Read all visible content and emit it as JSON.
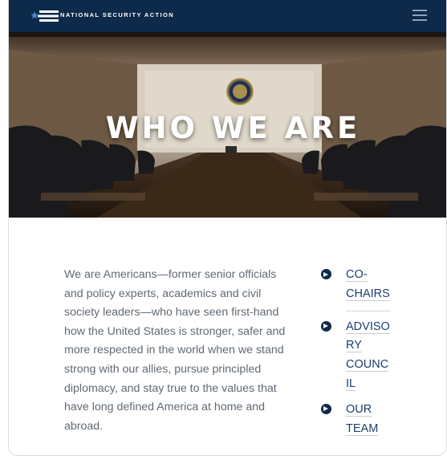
{
  "header": {
    "brand": "NATIONAL SECURITY ACTION",
    "logo_icon": "flag-stars-icon",
    "menu_icon": "hamburger-menu-icon"
  },
  "hero": {
    "title": "WHO WE ARE",
    "image": "situation-room-conference-table"
  },
  "intro": {
    "text": "We are Americans—former senior officials and policy experts, academics and civil society leaders—who have seen first-hand how the United States is stronger, safer and more respected in the world when we stand strong with our allies, pursue principled diplomacy, and stay true to the values that have long defined America at home and abroad."
  },
  "links": [
    {
      "label": "CO-CHAIRS",
      "icon": "arrow-circle-right-icon"
    },
    {
      "label": "ADVISORY COUNCIL",
      "icon": "arrow-circle-right-icon"
    },
    {
      "label": "OUR TEAM",
      "icon": "arrow-circle-right-icon"
    }
  ],
  "colors": {
    "navy": "#0d2a4a",
    "link": "#1a3f73",
    "body_text": "#606a74"
  }
}
